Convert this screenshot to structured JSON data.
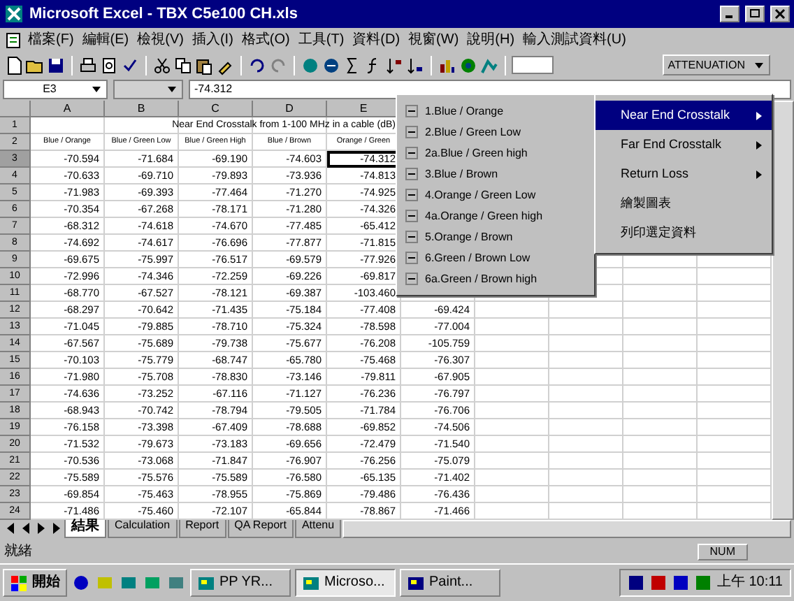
{
  "window": {
    "title": "Microsoft Excel - TBX C5e100 CH.xls"
  },
  "menu_bar": [
    "檔案(F)",
    "編輯(E)",
    "檢視(V)",
    "插入(I)",
    "格式(O)",
    "工具(T)",
    "資料(D)",
    "視窗(W)",
    "說明(H)",
    "輸入測試資料(U)"
  ],
  "toolbar": {
    "dropdown": "ATTENUATION"
  },
  "formula_bar": {
    "name_box": "E3",
    "value": "-74.312"
  },
  "columns": [
    "A",
    "B",
    "C",
    "D",
    "E"
  ],
  "title_row": {
    "header": "1",
    "text": "Near End Crosstalk from 1-100 MHz in a cable (dB)"
  },
  "header_row": {
    "header": "2",
    "cells": [
      "Blue / Orange",
      "Blue / Green Low",
      "Blue / Green High",
      "Blue / Brown",
      "Orange / Green"
    ]
  },
  "rows": [
    {
      "header": "3",
      "cells": [
        "-70.594",
        "-71.684",
        "-69.190",
        "-74.603",
        {
          "text": "-74.312",
          "selected": true
        }
      ]
    },
    {
      "header": "4",
      "cells": [
        "-70.633",
        "-69.710",
        "-79.893",
        "-73.936",
        "-74.813"
      ]
    },
    {
      "header": "5",
      "cells": [
        "-71.983",
        "-69.393",
        "-77.464",
        "-71.270",
        "-74.925"
      ]
    },
    {
      "header": "6",
      "cells": [
        "-70.354",
        "-67.268",
        "-78.171",
        "-71.280",
        "-74.326"
      ]
    },
    {
      "header": "7",
      "cells": [
        "-68.312",
        "-74.618",
        "-74.670",
        "-77.485",
        "-65.412"
      ]
    },
    {
      "header": "8",
      "cells": [
        "-74.692",
        "-74.617",
        "-76.696",
        "-77.877",
        "-71.815"
      ]
    },
    {
      "header": "9",
      "cells": [
        "-69.675",
        "-75.997",
        "-76.517",
        "-69.579",
        "-77.926"
      ]
    },
    {
      "header": "10",
      "cells": [
        "-72.996",
        "-74.346",
        "-72.259",
        "-69.226",
        "-69.817"
      ]
    },
    {
      "header": "11",
      "cells": [
        "-68.770",
        "-67.527",
        "-78.121",
        "-69.387",
        "-103.460"
      ]
    },
    {
      "header": "12",
      "cells": [
        "-68.297",
        "-70.642",
        "-71.435",
        "-75.184",
        "-77.408",
        "-69.424"
      ]
    },
    {
      "header": "13",
      "cells": [
        "-71.045",
        "-79.885",
        "-78.710",
        "-75.324",
        "-78.598",
        "-77.004"
      ]
    },
    {
      "header": "14",
      "cells": [
        "-67.567",
        "-75.689",
        "-79.738",
        "-75.677",
        "-76.208",
        "-105.759"
      ]
    },
    {
      "header": "15",
      "cells": [
        "-70.103",
        "-75.779",
        "-68.747",
        "-65.780",
        "-75.468",
        "-76.307"
      ]
    },
    {
      "header": "16",
      "cells": [
        "-71.980",
        "-75.708",
        "-78.830",
        "-73.146",
        "-79.811",
        "-67.905"
      ]
    },
    {
      "header": "17",
      "cells": [
        "-74.636",
        "-73.252",
        "-67.116",
        "-71.127",
        "-76.236",
        "-76.797"
      ]
    },
    {
      "header": "18",
      "cells": [
        "-68.943",
        "-70.742",
        "-78.794",
        "-79.505",
        "-71.784",
        "-76.706"
      ]
    },
    {
      "header": "19",
      "cells": [
        "-76.158",
        "-73.398",
        "-67.409",
        "-78.688",
        "-69.852",
        "-74.506"
      ]
    },
    {
      "header": "20",
      "cells": [
        "-71.532",
        "-79.673",
        "-73.183",
        "-69.656",
        "-72.479",
        "-71.540"
      ]
    },
    {
      "header": "21",
      "cells": [
        "-70.536",
        "-73.068",
        "-71.847",
        "-76.907",
        "-76.256",
        "-75.079"
      ]
    },
    {
      "header": "22",
      "cells": [
        "-75.589",
        "-75.576",
        "-75.589",
        "-76.580",
        "-65.135",
        "-71.402"
      ]
    },
    {
      "header": "23",
      "cells": [
        "-69.854",
        "-75.463",
        "-78.955",
        "-75.869",
        "-79.486",
        "-76.436"
      ]
    },
    {
      "header": "24",
      "cells": [
        "-71.486",
        "-75.460",
        "-72.107",
        "-65.844",
        "-78.867",
        "-71.466"
      ]
    }
  ],
  "menu": [
    {
      "label": "Near End Crosstalk",
      "has_submenu": true,
      "selected": true
    },
    {
      "label": "Far End Crosstalk",
      "has_submenu": true,
      "selected": false
    },
    {
      "label": "Return Loss",
      "has_submenu": true,
      "selected": false
    },
    {
      "label": "繪製圖表",
      "has_submenu": false,
      "selected": false
    },
    {
      "label": "列印選定資料",
      "has_submenu": false,
      "selected": false
    }
  ],
  "submenu": [
    "1.Blue / Orange",
    "2.Blue / Green Low",
    "2a.Blue / Green high",
    "3.Blue / Brown",
    "4.Orange / Green Low",
    "4a.Orange / Green high",
    "5.Orange / Brown",
    "6.Green / Brown Low",
    "6a.Green / Brown high"
  ],
  "sheet_tabs": [
    {
      "label": "結果",
      "selected": true
    },
    {
      "label": "Calculation",
      "selected": false
    },
    {
      "label": "Report",
      "selected": false
    },
    {
      "label": "QA Report",
      "selected": false
    },
    {
      "label": "Attenu",
      "selected": false
    }
  ],
  "status_bar": {
    "left": "就緒",
    "right": "NUM"
  },
  "taskbar": {
    "start": "開始",
    "tasks": [
      {
        "label": "PP YR...",
        "selected": false
      },
      {
        "label": "Microso...",
        "selected": true
      },
      {
        "label": "Paint...",
        "selected": false
      }
    ],
    "clock": "上午 10:11"
  }
}
